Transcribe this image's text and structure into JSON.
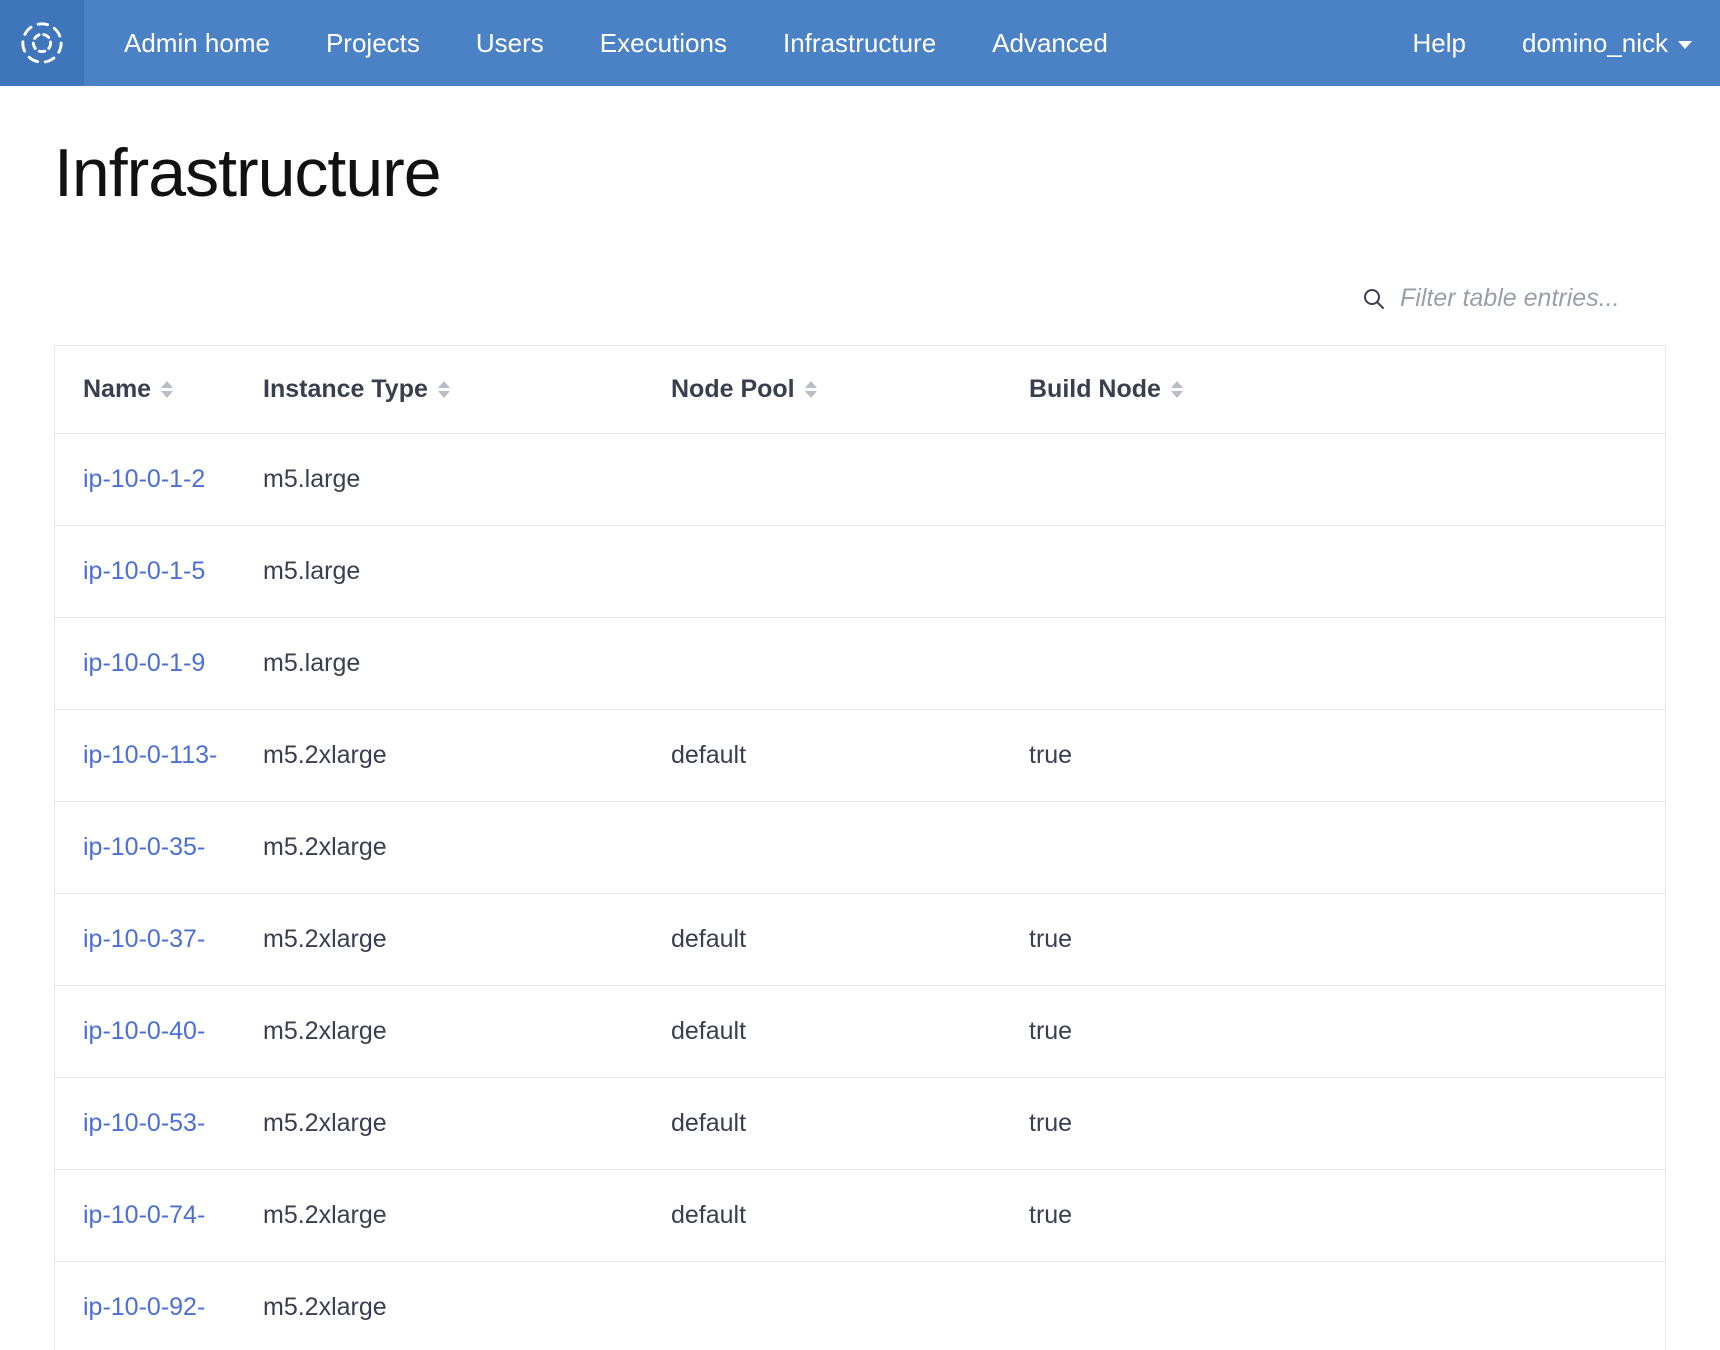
{
  "nav": {
    "items": [
      "Admin home",
      "Projects",
      "Users",
      "Executions",
      "Infrastructure",
      "Advanced"
    ],
    "help": "Help",
    "user": "domino_nick"
  },
  "page": {
    "title": "Infrastructure"
  },
  "filter": {
    "placeholder": "Filter table entries..."
  },
  "table": {
    "columns": [
      "Name",
      "Instance Type",
      "Node Pool",
      "Build Node"
    ],
    "rows": [
      {
        "name": "ip-10-0-1-2",
        "instance_type": "m5.large",
        "node_pool": "",
        "build_node": ""
      },
      {
        "name": "ip-10-0-1-5",
        "instance_type": "m5.large",
        "node_pool": "",
        "build_node": ""
      },
      {
        "name": "ip-10-0-1-9",
        "instance_type": "m5.large",
        "node_pool": "",
        "build_node": ""
      },
      {
        "name": "ip-10-0-113-",
        "instance_type": "m5.2xlarge",
        "node_pool": "default",
        "build_node": "true"
      },
      {
        "name": "ip-10-0-35-",
        "instance_type": "m5.2xlarge",
        "node_pool": "",
        "build_node": ""
      },
      {
        "name": "ip-10-0-37-",
        "instance_type": "m5.2xlarge",
        "node_pool": "default",
        "build_node": "true"
      },
      {
        "name": "ip-10-0-40-",
        "instance_type": "m5.2xlarge",
        "node_pool": "default",
        "build_node": "true"
      },
      {
        "name": "ip-10-0-53-",
        "instance_type": "m5.2xlarge",
        "node_pool": "default",
        "build_node": "true"
      },
      {
        "name": "ip-10-0-74-",
        "instance_type": "m5.2xlarge",
        "node_pool": "default",
        "build_node": "true"
      },
      {
        "name": "ip-10-0-92-",
        "instance_type": "m5.2xlarge",
        "node_pool": "",
        "build_node": ""
      }
    ]
  }
}
